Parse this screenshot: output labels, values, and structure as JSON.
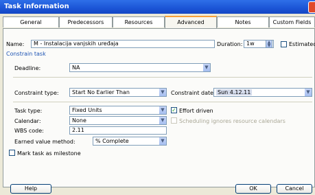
{
  "window": {
    "title": "Task Information"
  },
  "tabs": [
    {
      "label": "General"
    },
    {
      "label": "Predecessors"
    },
    {
      "label": "Resources"
    },
    {
      "label": "Advanced",
      "active": true
    },
    {
      "label": "Notes"
    },
    {
      "label": "Custom Fields"
    }
  ],
  "name": {
    "label": "Name:",
    "value": "M - Instalacija vanjskih uređaja"
  },
  "duration": {
    "label": "Duration:",
    "value": "1w",
    "estimated_label": "Estimated",
    "estimated_checked": false
  },
  "constrain": {
    "section_label": "Constrain task",
    "deadline_label": "Deadline:",
    "deadline_value": "NA",
    "type_label": "Constraint type:",
    "type_value": "Start No Earlier Than",
    "date_label": "Constraint date:",
    "date_value": "Sun 4.12.11"
  },
  "task": {
    "type_label": "Task type:",
    "type_value": "Fixed Units",
    "effort_label": "Effort driven",
    "effort_checked": true,
    "calendar_label": "Calendar:",
    "calendar_value": "None",
    "scheduling_label": "Scheduling ignores resource calendars",
    "wbs_label": "WBS code:",
    "wbs_value": "2.11",
    "ev_label": "Earned value method:",
    "ev_value": "% Complete",
    "milestone_label": "Mark task as milestone",
    "milestone_checked": false
  },
  "buttons": {
    "help": "Help",
    "ok": "OK",
    "cancel": "Cancel"
  },
  "colors": {
    "title_bar": "#1b55d6",
    "tab_active_accent": "#f7a03a",
    "section_text": "#1b52b3"
  }
}
